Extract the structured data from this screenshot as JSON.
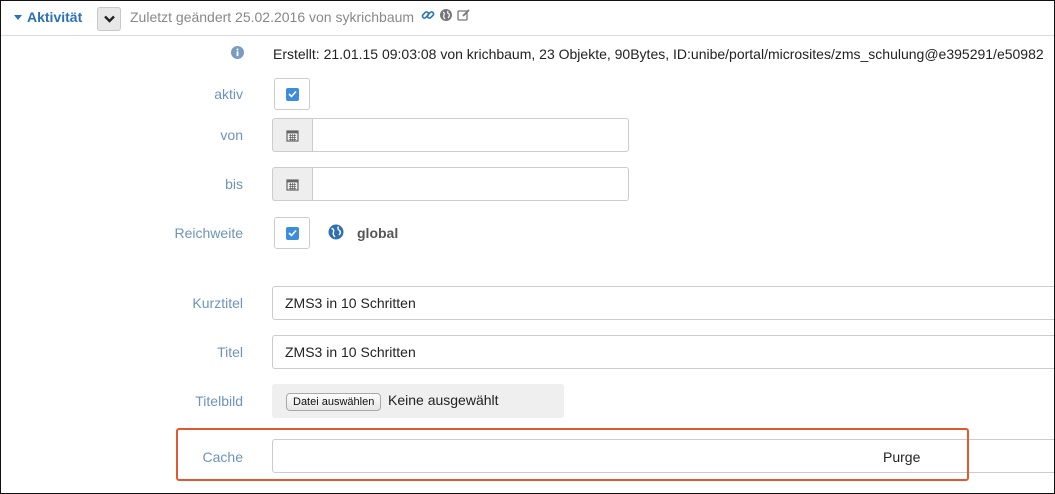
{
  "header": {
    "section_title": "Aktivität",
    "changed_text": "Zuletzt geändert 25.02.2016 von sykrichbaum"
  },
  "info": {
    "text": "Erstellt: 21.01.15 09:03:08 von krichbaum, 23 Objekte, 90Bytes, ID:unibe/portal/microsites/zms_schulung@e395291/e50982"
  },
  "fields": {
    "aktiv": {
      "label": "aktiv",
      "checked": true
    },
    "von": {
      "label": "von",
      "value": ""
    },
    "bis": {
      "label": "bis",
      "value": ""
    },
    "reichweite": {
      "label": "Reichweite",
      "checked": true,
      "scope_text": "global"
    },
    "kurztitel": {
      "label": "Kurztitel",
      "value": "ZMS3 in 10 Schritten"
    },
    "titel": {
      "label": "Titel",
      "value": "ZMS3 in 10 Schritten"
    },
    "titelbild": {
      "label": "Titelbild",
      "button_label": "Datei auswählen",
      "status": "Keine ausgewählt"
    },
    "cache": {
      "label": "Cache",
      "button_label": "Purge"
    }
  },
  "colors": {
    "accent": "#2a72b5",
    "label": "#6d93bd",
    "checkbox": "#3c8ddc",
    "highlight": "#e2582f"
  },
  "icons": {
    "section_caret": "caret-down-icon",
    "dropdown": "chevron-down-icon",
    "header_link": "link-icon",
    "header_globe": "globe-icon",
    "header_edit": "edit-icon",
    "info": "info-icon",
    "calendar": "calendar-icon",
    "scope": "globe-icon",
    "check": "check-icon"
  }
}
